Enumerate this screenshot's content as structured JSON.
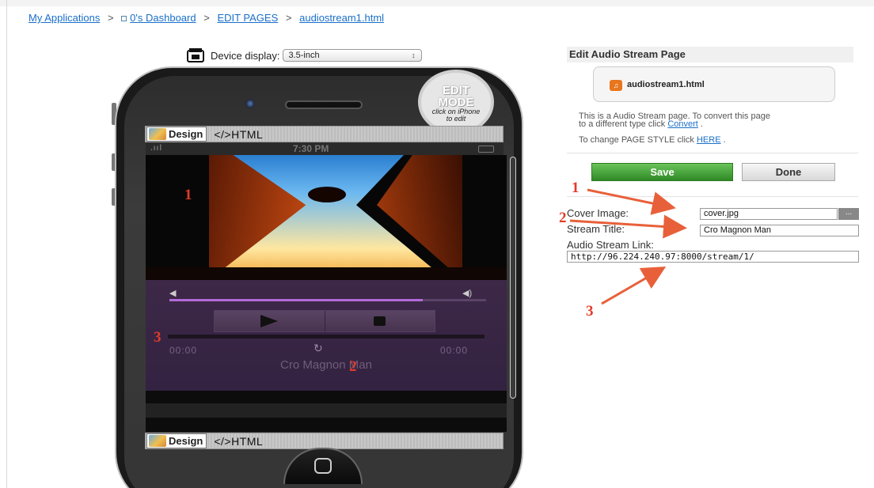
{
  "breadcrumb": {
    "my_apps": "My Applications",
    "dashboard": "0's Dashboard",
    "edit_pages": "EDIT PAGES",
    "current_page": "audiostream1.html",
    "separator": ">"
  },
  "device": {
    "label": "Device display:",
    "selected": "3.5-inch"
  },
  "badge": {
    "line1": "EDIT",
    "line2": "MODE",
    "line3": "click on iPhone",
    "line4": "to edit"
  },
  "tabs": {
    "design": "Design",
    "html": "</>HTML"
  },
  "phone_status": {
    "signal": ".ııl",
    "time": "7:30 PM"
  },
  "player": {
    "time_left": "00:00",
    "time_right": "00:00",
    "title": "Cro Magnon Man",
    "volume_level": 0.8,
    "repeat_glyph": "↻"
  },
  "panel": {
    "title": "Edit Audio Stream Page",
    "filename": "audiostream1.html",
    "info_line1": "This is a Audio Stream page. To convert this page",
    "info_line2_prefix": "to a different type click",
    "convert_link": "Convert",
    "style_prefix": "To change PAGE STYLE click",
    "here_link": "HERE",
    "save_label": "Save",
    "done_label": "Done"
  },
  "form": {
    "cover_label": "Cover Image:",
    "cover_value": "cover.jpg",
    "browse_label": "...",
    "title_label": "Stream Title:",
    "title_value": "Cro Magnon Man",
    "link_label": "Audio Stream Link:",
    "link_value": "http://96.224.240.97:8000/stream/1/"
  },
  "annotations": {
    "n1": "1",
    "n2": "2",
    "n3": "3"
  },
  "colors": {
    "link": "#1a6fc9",
    "annotation": "#e23b2a",
    "save": "#3c9a32",
    "player_bg": "#3d2847"
  }
}
